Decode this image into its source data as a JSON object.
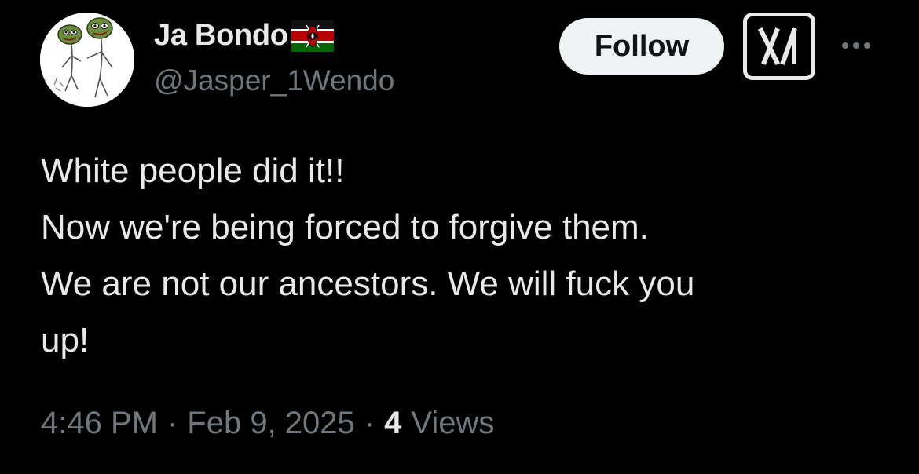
{
  "author": {
    "display_name": "Ja Bondo",
    "handle": "@Jasper_1Wendo",
    "badge_icon": "kenya-flag-emoji",
    "avatar_icon": "pepe-frogs-sketch-avatar"
  },
  "actions": {
    "follow_label": "Follow",
    "grok_icon": "grok-icon",
    "more_icon": "more-options-icon"
  },
  "tweet": {
    "lines": [
      "White people did it!!",
      "Now we're being forced to forgive them.",
      "We are not our ancestors. We will fuck you",
      "up!"
    ]
  },
  "meta": {
    "time": "4:46 PM",
    "separator": "·",
    "date": "Feb 9, 2025",
    "views_count": "4",
    "views_label": "Views"
  },
  "colors": {
    "background": "#000000",
    "primary_text": "#e7e9ea",
    "secondary_text": "#71767b",
    "follow_bg": "#eff3f4"
  }
}
